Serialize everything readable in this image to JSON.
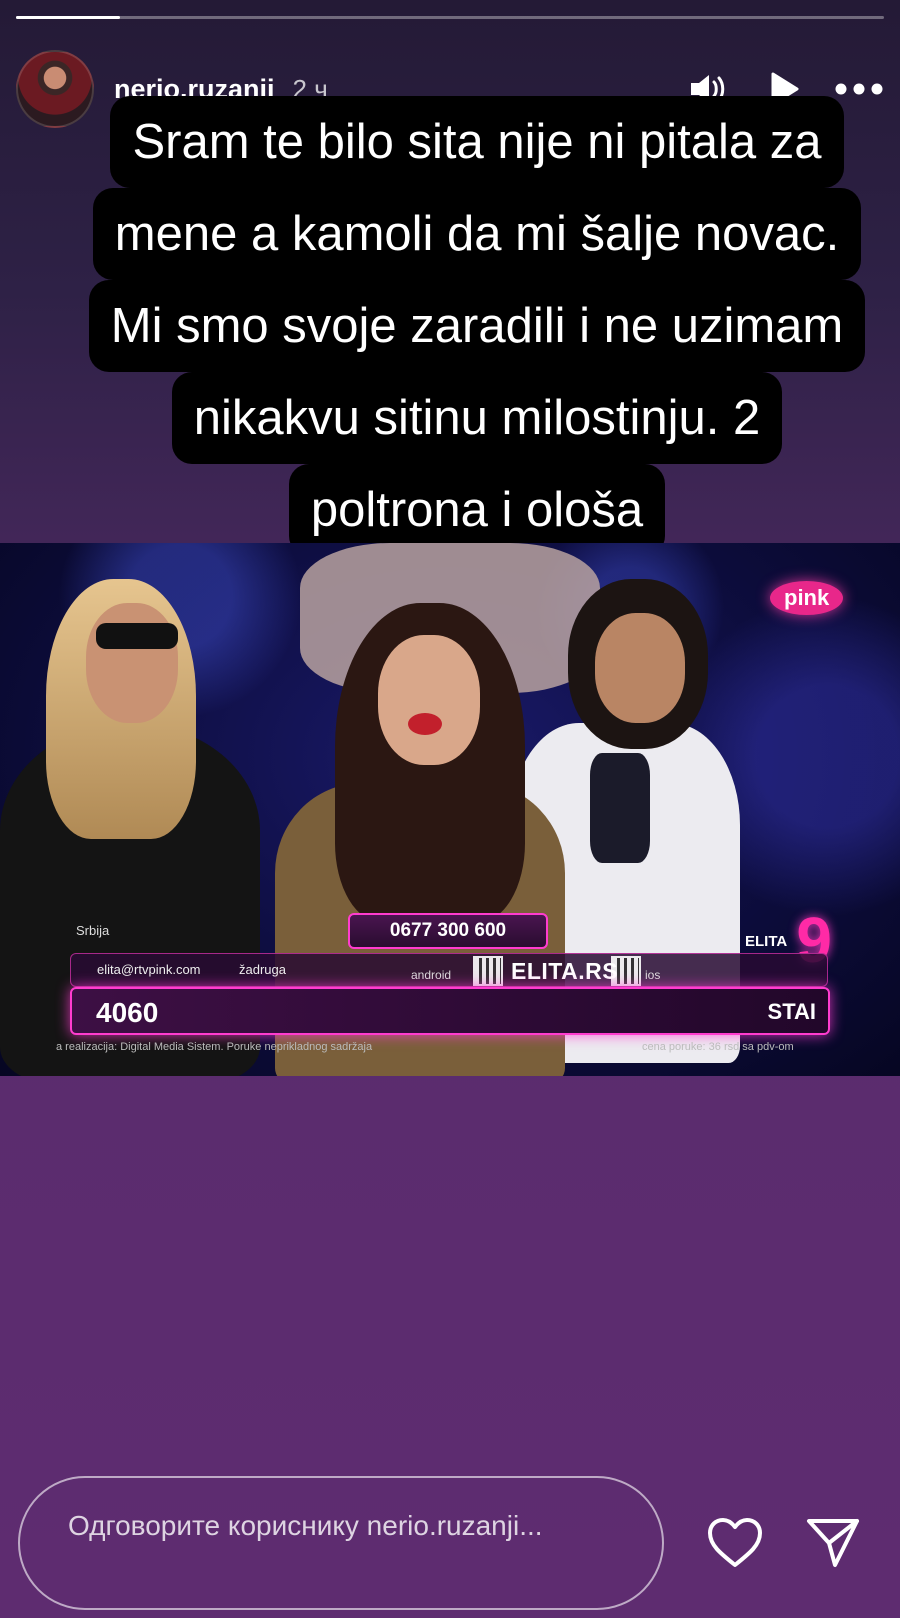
{
  "story": {
    "progress": 0.12,
    "username": "nerio.ruzanji",
    "time": "2 ч",
    "caption_lines": [
      "Sram te bilo sita nije ni pitala za",
      "mene a kamoli da mi šalje novac.",
      "Mi smo svoje zaradili i ne uzimam",
      "nikakvu sitinu milostinju. 2",
      "poltrona i ološa"
    ]
  },
  "header_icons": {
    "sound": "speaker-icon",
    "play": "play-icon",
    "more": "more-icon"
  },
  "media": {
    "channel_logo": "pink",
    "show_logo": "9",
    "show_logo_text": "ELITA",
    "country": "Srbija",
    "phone": "0677 300 600",
    "email": "elita@rtvpink.com",
    "tag": "žadruga",
    "android_label": "android",
    "site": "ELITA.RS",
    "ios_label": "ios",
    "count": "4060",
    "status": "STAI",
    "fine_left": "a realizacija: Digital Media Sistem. Poruke neprikladnog sadržaja",
    "fine_right": "cena poruke: 36 rsd sa pdv-om"
  },
  "reply": {
    "placeholder": "Одговорите кориснику nerio.ruzanji..."
  },
  "footer_icons": {
    "like": "heart-icon",
    "share": "send-icon"
  }
}
